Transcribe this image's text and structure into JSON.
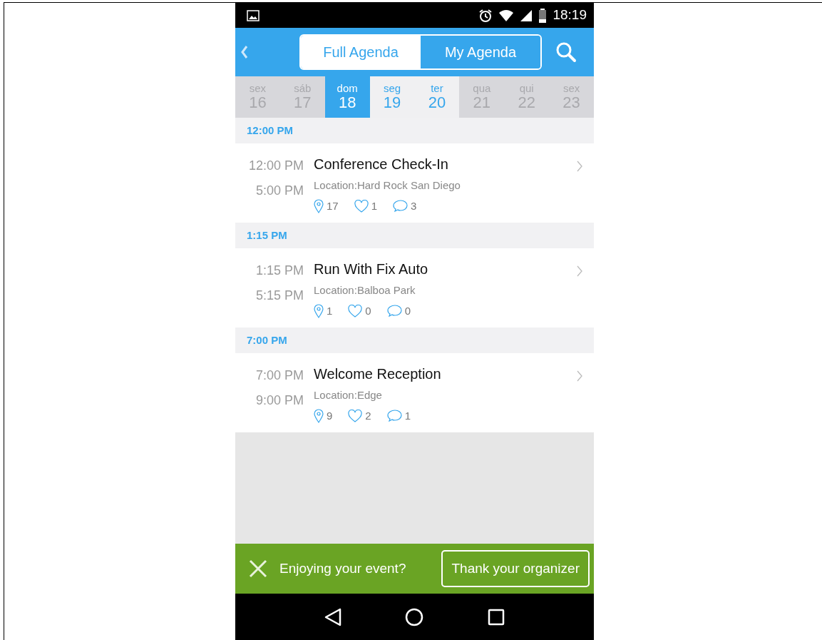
{
  "status_bar": {
    "time": "18:19"
  },
  "header": {
    "tabs": [
      {
        "label": "Full Agenda",
        "selected": false
      },
      {
        "label": "My Agenda",
        "selected": true
      }
    ]
  },
  "days": [
    {
      "weekday": "sex",
      "day": "16",
      "selected": false,
      "highlighted": false
    },
    {
      "weekday": "sáb",
      "day": "17",
      "selected": false,
      "highlighted": false
    },
    {
      "weekday": "dom",
      "day": "18",
      "selected": true
    },
    {
      "weekday": "seg",
      "day": "19",
      "selected": false,
      "highlighted": true
    },
    {
      "weekday": "ter",
      "day": "20",
      "selected": false,
      "highlighted": true
    },
    {
      "weekday": "qua",
      "day": "21",
      "selected": false,
      "highlighted": false
    },
    {
      "weekday": "qui",
      "day": "22",
      "selected": false,
      "highlighted": false
    },
    {
      "weekday": "sex",
      "day": "23",
      "selected": false,
      "highlighted": false
    }
  ],
  "sections": [
    {
      "heading": "12:00 PM",
      "events": [
        {
          "start": "12:00 PM",
          "end": "5:00 PM",
          "title": "Conference Check-In",
          "location": "Location:Hard Rock San Diego",
          "checkins": "17",
          "likes": "1",
          "comments": "3"
        }
      ]
    },
    {
      "heading": "1:15 PM",
      "events": [
        {
          "start": "1:15 PM",
          "end": "5:15 PM",
          "title": "Run With Fix Auto",
          "location": "Location:Balboa Park",
          "checkins": "1",
          "likes": "0",
          "comments": "0"
        }
      ]
    },
    {
      "heading": "7:00 PM",
      "events": [
        {
          "start": "7:00 PM",
          "end": "9:00 PM",
          "title": "Welcome Reception",
          "location": "Location:Edge",
          "checkins": "9",
          "likes": "2",
          "comments": "1"
        }
      ]
    }
  ],
  "banner": {
    "message": "Enjoying your event?",
    "button": "Thank your organizer"
  }
}
